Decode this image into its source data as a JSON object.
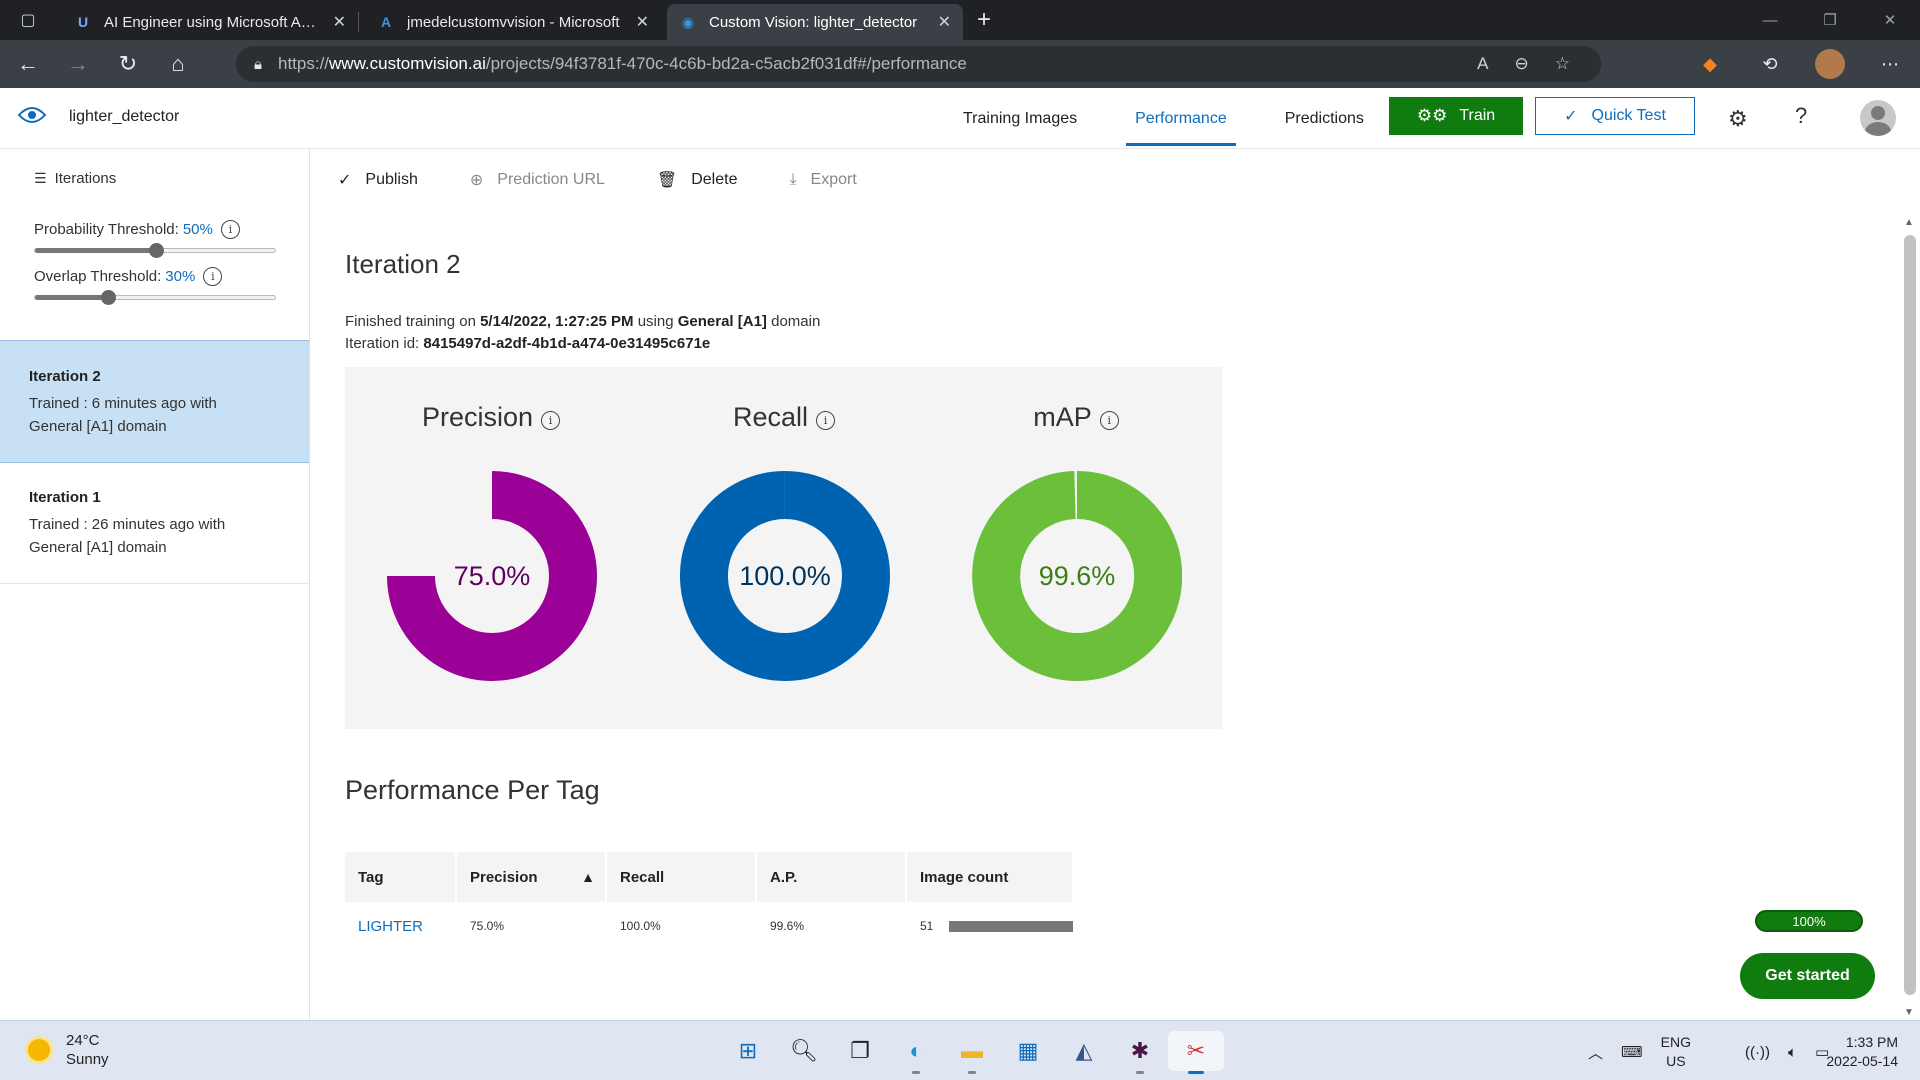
{
  "browser": {
    "tabs": [
      {
        "title": "AI Engineer using Microsoft Azure",
        "icon": "udemy-icon",
        "active": false
      },
      {
        "title": "jmedelcustomvvision - Microsoft",
        "icon": "azure-icon",
        "active": false
      },
      {
        "title": "Custom Vision: lighter_detector",
        "icon": "customvision-icon",
        "active": true
      }
    ],
    "url_prefix": "https://",
    "url_host": "www.customvision.ai",
    "url_path": "/projects/94f3781f-470c-4c6b-bd2a-c5acb2f031df#/performance"
  },
  "header": {
    "project_name": "lighter_detector",
    "nav": [
      {
        "label": "Training Images",
        "active": false
      },
      {
        "label": "Performance",
        "active": true
      },
      {
        "label": "Predictions",
        "active": false
      }
    ],
    "train_label": "Train",
    "quick_test_label": "Quick Test"
  },
  "sidebar": {
    "iterations_label": "Iterations",
    "probability_label": "Probability Threshold:",
    "probability_value": "50%",
    "probability_level": 0.5,
    "overlap_label": "Overlap Threshold:",
    "overlap_value": "30%",
    "overlap_level": 0.3,
    "items": [
      {
        "name": "Iteration 2",
        "line1": "Trained : 6 minutes ago with",
        "line2": "General [A1] domain",
        "selected": true
      },
      {
        "name": "Iteration 1",
        "line1": "Trained : 26 minutes ago with",
        "line2": "General [A1] domain",
        "selected": false
      }
    ]
  },
  "toolbar": {
    "publish": "Publish",
    "prediction_url": "Prediction URL",
    "delete": "Delete",
    "export": "Export"
  },
  "main": {
    "iteration_title": "Iteration 2",
    "finished_prefix": "Finished training on",
    "finished_date": "5/14/2022, 1:27:25 PM",
    "using_word": "using",
    "domain_name": "General [A1]",
    "domain_word": "domain",
    "iteration_id_label": "Iteration id:",
    "iteration_id": "8415497d-a2df-4b1d-a474-0e31495c671e",
    "metrics": [
      {
        "label": "Precision",
        "value": "75.0%",
        "fraction": 0.75,
        "color": "#9b0097",
        "text_color": "#5e0060",
        "track": "none"
      },
      {
        "label": "Recall",
        "value": "100.0%",
        "fraction": 1.0,
        "color": "#0063b1",
        "text_color": "#00335c",
        "track": "none"
      },
      {
        "label": "mAP",
        "value": "99.6%",
        "fraction": 0.996,
        "color": "#6bbf3a",
        "text_color": "#3d7f17",
        "track": "none"
      }
    ],
    "per_tag_title": "Performance Per Tag",
    "table": {
      "headers": [
        "Tag",
        "Precision",
        "Recall",
        "A.P.",
        "Image count"
      ],
      "rows": [
        {
          "tag": "LIGHTER",
          "precision": "75.0%",
          "recall": "100.0%",
          "ap": "99.6%",
          "count": "51"
        }
      ]
    },
    "progress_label": "100%",
    "get_started": "Get started"
  },
  "taskbar": {
    "temp": "24°C",
    "weather": "Sunny",
    "lang1": "ENG",
    "lang2": "US",
    "time": "1:33 PM",
    "date": "2022-05-14"
  }
}
